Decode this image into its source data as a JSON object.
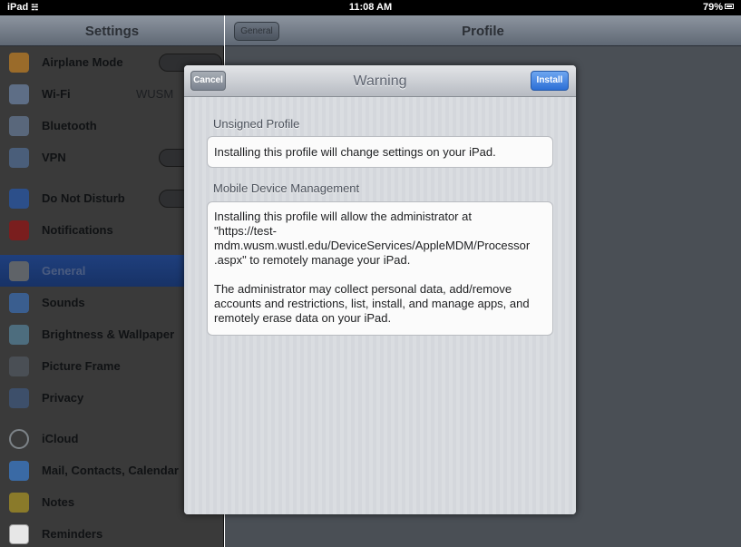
{
  "status_bar": {
    "carrier": "iPad",
    "time": "11:08 AM",
    "battery": "79%"
  },
  "master": {
    "title": "Settings",
    "groups": [
      [
        {
          "label": "Airplane Mode",
          "icon": "airplane-icon"
        },
        {
          "label": "Wi-Fi",
          "value": "WUSM",
          "icon": "wifi-icon"
        },
        {
          "label": "Bluetooth",
          "icon": "bluetooth-icon"
        },
        {
          "label": "VPN",
          "icon": "vpn-icon"
        }
      ],
      [
        {
          "label": "Do Not Disturb",
          "icon": "moon-icon"
        },
        {
          "label": "Notifications",
          "icon": "notifications-icon"
        }
      ],
      [
        {
          "label": "General",
          "icon": "gear-icon",
          "selected": true
        },
        {
          "label": "Sounds",
          "icon": "speaker-icon"
        },
        {
          "label": "Brightness & Wallpaper",
          "icon": "brightness-icon"
        },
        {
          "label": "Picture Frame",
          "icon": "picture-frame-icon"
        },
        {
          "label": "Privacy",
          "icon": "hand-icon"
        }
      ],
      [
        {
          "label": "iCloud",
          "icon": "cloud-icon"
        },
        {
          "label": "Mail, Contacts, Calendar",
          "icon": "mail-icon"
        },
        {
          "label": "Notes",
          "icon": "notes-icon"
        },
        {
          "label": "Reminders",
          "icon": "reminders-icon"
        }
      ]
    ]
  },
  "detail": {
    "back_label": "General",
    "title": "Profile"
  },
  "modal": {
    "title": "Warning",
    "cancel_label": "Cancel",
    "install_label": "Install",
    "section1_title": "Unsigned Profile",
    "section1_text": "Installing this profile will change settings on your iPad.",
    "section2_title": "Mobile Device Management",
    "section2_para1": "Installing this profile will allow the administrator at\n\"https://test-\nmdm.wusm.wustl.edu/DeviceServices/AppleMDM/Processor\n.aspx\" to remotely manage your iPad.",
    "section2_para2": "The administrator may collect personal data, add/remove\naccounts and restrictions, list, install, and manage apps, and\nremotely erase data on your iPad."
  },
  "colors": {
    "selected_row": "#1f3f7d",
    "install_button": "#2c6fd6",
    "cancel_button": "#7b838f"
  }
}
